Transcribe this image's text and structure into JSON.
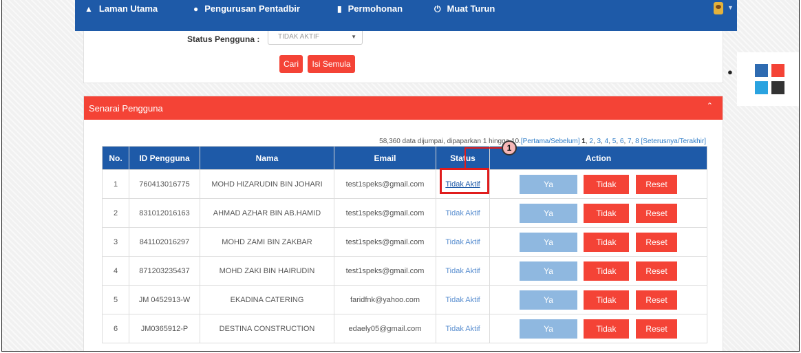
{
  "nav": {
    "items": [
      {
        "label": "Laman Utama",
        "icon": "home-icon"
      },
      {
        "label": "Pengurusan Pentadbir",
        "icon": "user-icon"
      },
      {
        "label": "Permohonan",
        "icon": "book-icon"
      },
      {
        "label": "Muat Turun",
        "icon": "power-icon"
      }
    ]
  },
  "search": {
    "status_label": "Status Pengguna :",
    "status_value": "TIDAK AKTIF",
    "search_button": "Cari",
    "reset_button": "Isi Semula"
  },
  "palette": {
    "colors": [
      "#2e6bb1",
      "#f44336",
      "#2aa3e0",
      "#333333"
    ]
  },
  "panel": {
    "title": "Senarai Pengguna",
    "info_text": "58,360 data dijumpai, dipaparkan 1 hingga 10.",
    "first_prev": "[Pertama/Sebelum]",
    "current_page": "1",
    "pages": [
      "2",
      "3",
      "4",
      "5",
      "6",
      "7",
      "8"
    ],
    "next_last": "[Seterusnya/Terakhir]"
  },
  "table": {
    "headers": [
      "No.",
      "ID Pengguna",
      "Nama",
      "Email",
      "Status",
      "Action"
    ],
    "action_labels": {
      "ya": "Ya",
      "tidak": "Tidak",
      "reset": "Reset"
    },
    "rows": [
      {
        "no": "1",
        "id": "760413016775",
        "nama": "MOHD HIZARUDIN BIN JOHARI",
        "email": "test1speks@gmail.com",
        "status": "Tidak Aktif"
      },
      {
        "no": "2",
        "id": "831012016163",
        "nama": "AHMAD AZHAR BIN AB.HAMID",
        "email": "test1speks@gmail.com",
        "status": "Tidak Aktif"
      },
      {
        "no": "3",
        "id": "841102016297",
        "nama": "MOHD ZAMI BIN ZAKBAR",
        "email": "test1speks@gmail.com",
        "status": "Tidak Aktif"
      },
      {
        "no": "4",
        "id": "871203235437",
        "nama": "MOHD ZAKI BIN HAIRUDIN",
        "email": "test1speks@gmail.com",
        "status": "Tidak Aktif"
      },
      {
        "no": "5",
        "id": "JM 0452913-W",
        "nama": "EKADINA CATERING",
        "email": "faridfnk@yahoo.com",
        "status": "Tidak Aktif"
      },
      {
        "no": "6",
        "id": "JM0365912-P",
        "nama": "DESTINA CONSTRUCTION",
        "email": "edaely05@gmail.com",
        "status": "Tidak Aktif"
      }
    ]
  },
  "annotation": {
    "label": "1"
  }
}
